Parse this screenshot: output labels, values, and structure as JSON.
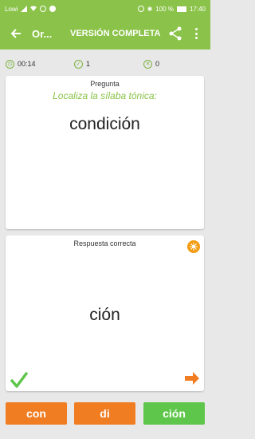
{
  "status": {
    "carrier": "Lowi",
    "battery": "100 %",
    "time": "17:40"
  },
  "appbar": {
    "title": "Or...",
    "full_version": "VERSIÓN COMPLETA"
  },
  "stats": {
    "time": "00:14",
    "correct": "1",
    "wrong": "0"
  },
  "question": {
    "label": "Pregunta",
    "instruction": "Localiza la sílaba tónica:",
    "word": "condición"
  },
  "answer": {
    "label": "Respuesta correcta",
    "syllable": "ción"
  },
  "syllables": [
    "con",
    "di",
    "ción"
  ],
  "colors": {
    "primary": "#8bc34a",
    "orange": "#f07d22",
    "green": "#5ec64a"
  }
}
